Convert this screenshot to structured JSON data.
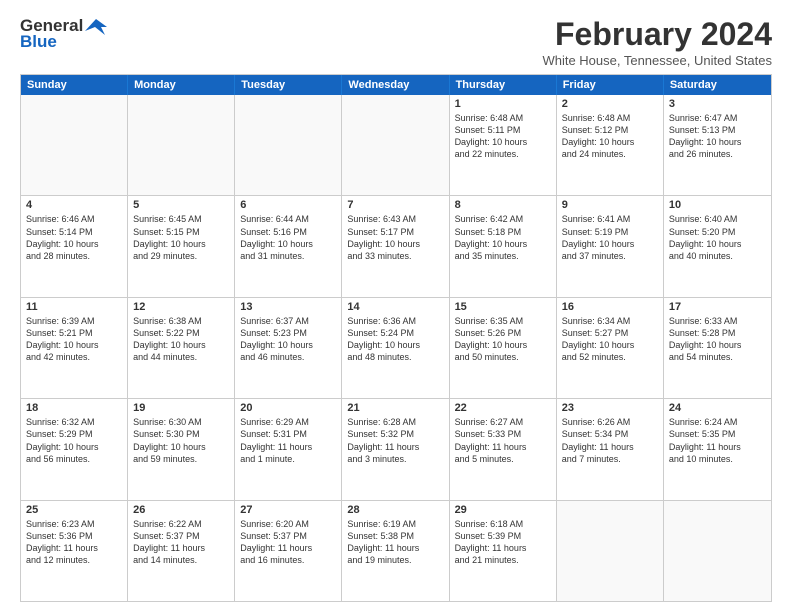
{
  "header": {
    "logo_general": "General",
    "logo_blue": "Blue",
    "month_title": "February 2024",
    "location": "White House, Tennessee, United States"
  },
  "days_of_week": [
    "Sunday",
    "Monday",
    "Tuesday",
    "Wednesday",
    "Thursday",
    "Friday",
    "Saturday"
  ],
  "weeks": [
    [
      {
        "num": "",
        "info": ""
      },
      {
        "num": "",
        "info": ""
      },
      {
        "num": "",
        "info": ""
      },
      {
        "num": "",
        "info": ""
      },
      {
        "num": "1",
        "info": "Sunrise: 6:48 AM\nSunset: 5:11 PM\nDaylight: 10 hours\nand 22 minutes."
      },
      {
        "num": "2",
        "info": "Sunrise: 6:48 AM\nSunset: 5:12 PM\nDaylight: 10 hours\nand 24 minutes."
      },
      {
        "num": "3",
        "info": "Sunrise: 6:47 AM\nSunset: 5:13 PM\nDaylight: 10 hours\nand 26 minutes."
      }
    ],
    [
      {
        "num": "4",
        "info": "Sunrise: 6:46 AM\nSunset: 5:14 PM\nDaylight: 10 hours\nand 28 minutes."
      },
      {
        "num": "5",
        "info": "Sunrise: 6:45 AM\nSunset: 5:15 PM\nDaylight: 10 hours\nand 29 minutes."
      },
      {
        "num": "6",
        "info": "Sunrise: 6:44 AM\nSunset: 5:16 PM\nDaylight: 10 hours\nand 31 minutes."
      },
      {
        "num": "7",
        "info": "Sunrise: 6:43 AM\nSunset: 5:17 PM\nDaylight: 10 hours\nand 33 minutes."
      },
      {
        "num": "8",
        "info": "Sunrise: 6:42 AM\nSunset: 5:18 PM\nDaylight: 10 hours\nand 35 minutes."
      },
      {
        "num": "9",
        "info": "Sunrise: 6:41 AM\nSunset: 5:19 PM\nDaylight: 10 hours\nand 37 minutes."
      },
      {
        "num": "10",
        "info": "Sunrise: 6:40 AM\nSunset: 5:20 PM\nDaylight: 10 hours\nand 40 minutes."
      }
    ],
    [
      {
        "num": "11",
        "info": "Sunrise: 6:39 AM\nSunset: 5:21 PM\nDaylight: 10 hours\nand 42 minutes."
      },
      {
        "num": "12",
        "info": "Sunrise: 6:38 AM\nSunset: 5:22 PM\nDaylight: 10 hours\nand 44 minutes."
      },
      {
        "num": "13",
        "info": "Sunrise: 6:37 AM\nSunset: 5:23 PM\nDaylight: 10 hours\nand 46 minutes."
      },
      {
        "num": "14",
        "info": "Sunrise: 6:36 AM\nSunset: 5:24 PM\nDaylight: 10 hours\nand 48 minutes."
      },
      {
        "num": "15",
        "info": "Sunrise: 6:35 AM\nSunset: 5:26 PM\nDaylight: 10 hours\nand 50 minutes."
      },
      {
        "num": "16",
        "info": "Sunrise: 6:34 AM\nSunset: 5:27 PM\nDaylight: 10 hours\nand 52 minutes."
      },
      {
        "num": "17",
        "info": "Sunrise: 6:33 AM\nSunset: 5:28 PM\nDaylight: 10 hours\nand 54 minutes."
      }
    ],
    [
      {
        "num": "18",
        "info": "Sunrise: 6:32 AM\nSunset: 5:29 PM\nDaylight: 10 hours\nand 56 minutes."
      },
      {
        "num": "19",
        "info": "Sunrise: 6:30 AM\nSunset: 5:30 PM\nDaylight: 10 hours\nand 59 minutes."
      },
      {
        "num": "20",
        "info": "Sunrise: 6:29 AM\nSunset: 5:31 PM\nDaylight: 11 hours\nand 1 minute."
      },
      {
        "num": "21",
        "info": "Sunrise: 6:28 AM\nSunset: 5:32 PM\nDaylight: 11 hours\nand 3 minutes."
      },
      {
        "num": "22",
        "info": "Sunrise: 6:27 AM\nSunset: 5:33 PM\nDaylight: 11 hours\nand 5 minutes."
      },
      {
        "num": "23",
        "info": "Sunrise: 6:26 AM\nSunset: 5:34 PM\nDaylight: 11 hours\nand 7 minutes."
      },
      {
        "num": "24",
        "info": "Sunrise: 6:24 AM\nSunset: 5:35 PM\nDaylight: 11 hours\nand 10 minutes."
      }
    ],
    [
      {
        "num": "25",
        "info": "Sunrise: 6:23 AM\nSunset: 5:36 PM\nDaylight: 11 hours\nand 12 minutes."
      },
      {
        "num": "26",
        "info": "Sunrise: 6:22 AM\nSunset: 5:37 PM\nDaylight: 11 hours\nand 14 minutes."
      },
      {
        "num": "27",
        "info": "Sunrise: 6:20 AM\nSunset: 5:37 PM\nDaylight: 11 hours\nand 16 minutes."
      },
      {
        "num": "28",
        "info": "Sunrise: 6:19 AM\nSunset: 5:38 PM\nDaylight: 11 hours\nand 19 minutes."
      },
      {
        "num": "29",
        "info": "Sunrise: 6:18 AM\nSunset: 5:39 PM\nDaylight: 11 hours\nand 21 minutes."
      },
      {
        "num": "",
        "info": ""
      },
      {
        "num": "",
        "info": ""
      }
    ]
  ]
}
